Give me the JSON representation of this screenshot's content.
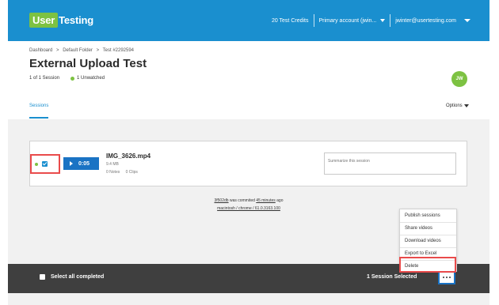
{
  "topbar": {
    "logo_part1": "User",
    "logo_part2": "Testing",
    "credits": "20 Test Credits",
    "account": "Primary account (jwin...",
    "email": "jwinter@usertesting.com"
  },
  "header": {
    "breadcrumb": [
      "Dashboard",
      ">",
      "Default Folder",
      ">",
      "Test #2292594"
    ],
    "title": "External Upload Test",
    "session_count": "1 of 1 Session",
    "unwatched": "1 Unwatched",
    "avatar_initials": "JW",
    "tab_sessions": "Sessions",
    "options_label": "Options"
  },
  "session": {
    "duration": "0:05",
    "file_name": "IMG_3626.mp4",
    "file_size": "9.4 MB",
    "notes": "0 Notes",
    "clips": "0 Clips",
    "summary_placeholder": "Summarize this session"
  },
  "commit": {
    "hash": "3f502db",
    "text1": "was commited",
    "time": "45 minutes",
    "text2": "ago",
    "platform": "macintosh / chrome / 61.0.3163.100"
  },
  "menu": {
    "items": [
      "Publish sessions",
      "Share videos",
      "Download videos",
      "Export to Excel",
      "Delete"
    ]
  },
  "bottombar": {
    "select_all": "Select all completed",
    "selected": "1 Session Selected"
  }
}
